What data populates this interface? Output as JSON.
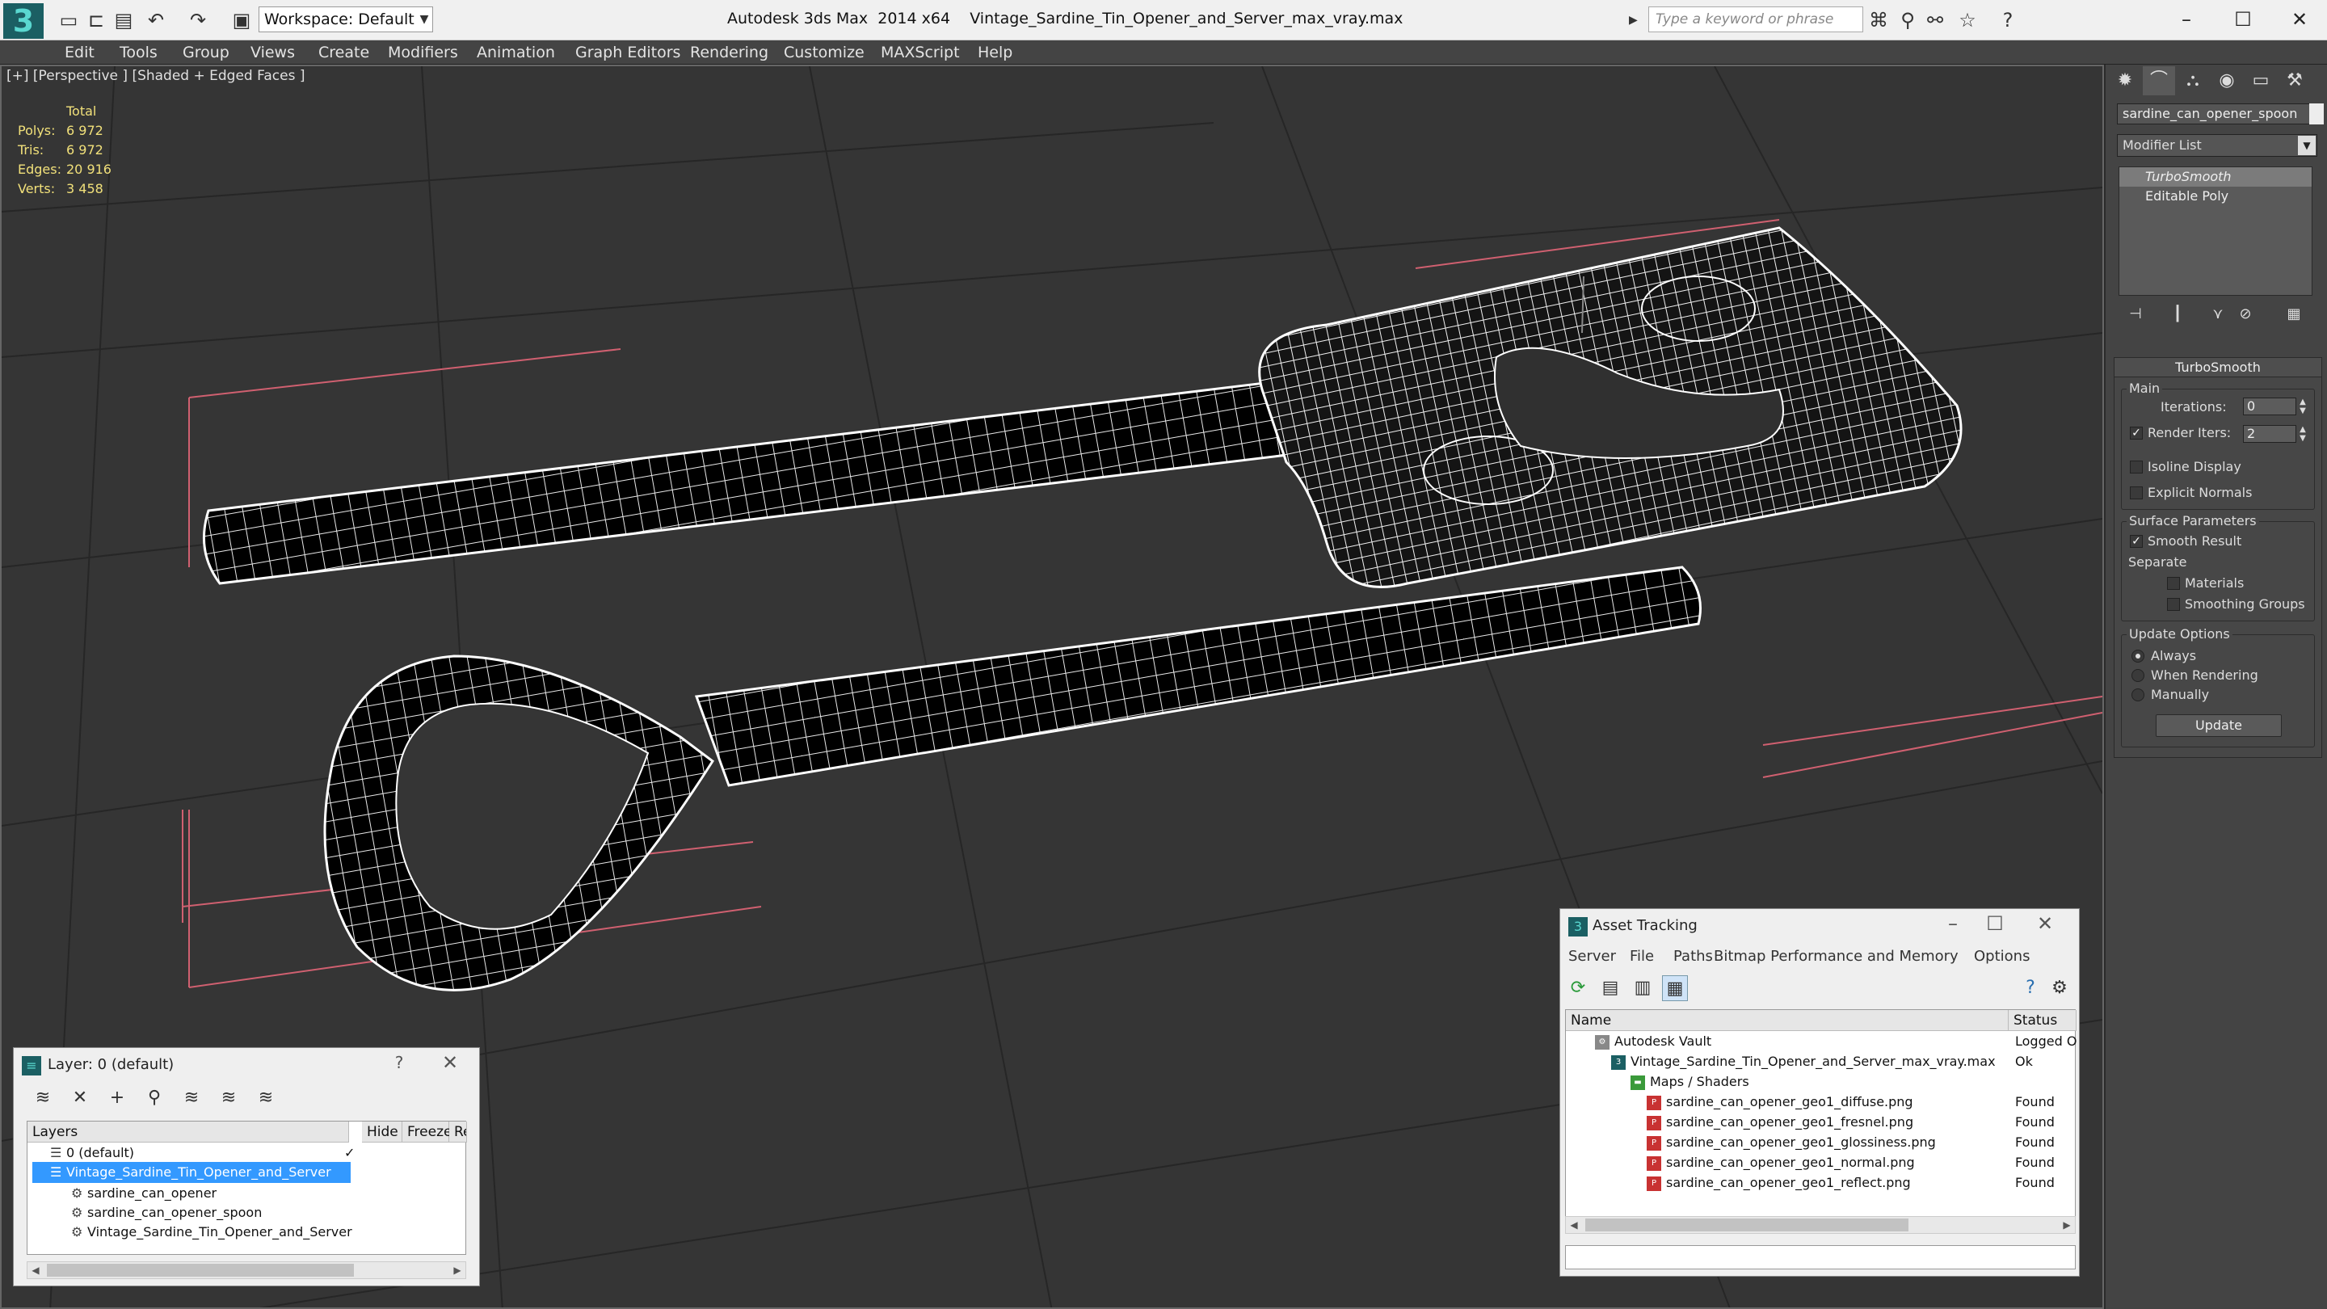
{
  "app": {
    "title": "Autodesk 3ds Max  2014 x64    Vintage_Sardine_Tin_Opener_and_Server_max_vray.max",
    "logo": "3",
    "workspace": "Workspace: Default",
    "search_placeholder": "Type a keyword or phrase"
  },
  "menu": [
    "Edit",
    "Tools",
    "Group",
    "Views",
    "Create",
    "Modifiers",
    "Animation",
    "Graph Editors",
    "Rendering",
    "Customize",
    "MAXScript",
    "Help"
  ],
  "viewport": {
    "label": "[+] [Perspective ] [Shaded + Edged Faces ]",
    "stats": {
      "header": "Total",
      "rows": [
        {
          "label": "Polys:",
          "value": "6 972"
        },
        {
          "label": "Tris:",
          "value": "6 972"
        },
        {
          "label": "Edges:",
          "value": "20 916"
        },
        {
          "label": "Verts:",
          "value": "3 458"
        }
      ]
    }
  },
  "command_panel": {
    "object_name": "sardine_can_opener_spoon",
    "modifier_list": "Modifier List",
    "stack": [
      "TurboSmooth",
      "Editable Poly"
    ],
    "rollout_title": "TurboSmooth",
    "main": {
      "group": "Main",
      "iterations_label": "Iterations:",
      "iterations": "0",
      "render_iters_label": "Render Iters:",
      "render_iters": "2",
      "isoline": "Isoline Display",
      "explicit_normals": "Explicit Normals"
    },
    "surface": {
      "group": "Surface Parameters",
      "smooth_result": "Smooth Result",
      "separate": "Separate",
      "materials": "Materials",
      "smoothing_groups": "Smoothing Groups"
    },
    "update": {
      "group": "Update Options",
      "always": "Always",
      "when_rendering": "When Rendering",
      "manually": "Manually",
      "button": "Update"
    }
  },
  "layer_dialog": {
    "title": "Layer: 0 (default)",
    "help": "?",
    "close": "✕",
    "columns": [
      "Layers",
      "Hide",
      "Freeze",
      "Ren"
    ],
    "rows": [
      {
        "name": "0 (default)",
        "indent": 0
      },
      {
        "name": "Vintage_Sardine_Tin_Opener_and_Server",
        "indent": 0
      },
      {
        "name": "sardine_can_opener",
        "indent": 1
      },
      {
        "name": "sardine_can_opener_spoon",
        "indent": 1
      },
      {
        "name": "Vintage_Sardine_Tin_Opener_and_Server",
        "indent": 1
      }
    ]
  },
  "asset_dialog": {
    "title": "Asset Tracking",
    "menu": [
      "Server",
      "File",
      "Paths",
      "Bitmap Performance and Memory",
      "Options"
    ],
    "columns": [
      "Name",
      "Status"
    ],
    "rows": [
      {
        "name": "Autodesk Vault",
        "status": "Logged O"
      },
      {
        "name": "Vintage_Sardine_Tin_Opener_and_Server_max_vray.max",
        "status": "Ok"
      },
      {
        "name": "Maps / Shaders",
        "status": ""
      },
      {
        "name": "sardine_can_opener_geo1_diffuse.png",
        "status": "Found"
      },
      {
        "name": "sardine_can_opener_geo1_fresnel.png",
        "status": "Found"
      },
      {
        "name": "sardine_can_opener_geo1_glossiness.png",
        "status": "Found"
      },
      {
        "name": "sardine_can_opener_geo1_normal.png",
        "status": "Found"
      },
      {
        "name": "sardine_can_opener_geo1_reflect.png",
        "status": "Found"
      }
    ]
  },
  "colors": {
    "accent": "#1f8bd1",
    "selection": "#3399ff",
    "viewport_bg": "#353535",
    "wire": "#ffffff",
    "stat_text": "#f1e07a"
  }
}
